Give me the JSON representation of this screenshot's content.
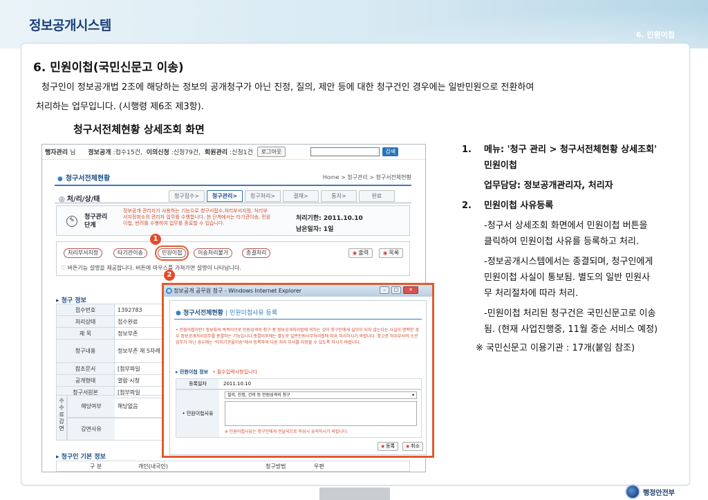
{
  "slide": {
    "title": "정보공개시스템",
    "chapter": "6. 민원이첩",
    "section_title": "6. 민원이첩(국민신문고 이송)",
    "intro_line1": "청구인이 정보공개법 2조에 해당하는 정보의 공개청구가 아닌 진정, 질의, 제안 등에 대한 청구건인 경우에는 일반민원으로 전환하여",
    "intro_line2": "처리하는 업무입니다. (시행령 제6조 제3항).",
    "sub_title": "청구서전체현황 상세조회 화면"
  },
  "screenshot": {
    "topbar": {
      "user": "행자관리",
      "user_suffix": "님",
      "info_label": "정보공개",
      "info_value": ":접수15건,",
      "petition_label": "이의신청",
      "petition_value": ":신청79건,",
      "member_label": "회원관리",
      "member_value": ":신청1건",
      "logout": "로그아웃",
      "search": "검색"
    },
    "page_heading": "청구서전체현황",
    "breadcrumb": "Home > 청구관리 > 청구서전체현황",
    "sub_heading": "처/리/상/태",
    "tabs": [
      "청구접수>",
      "청구관리>",
      "청구처리>",
      "결재>",
      "통지>",
      "완료"
    ],
    "status": {
      "label": "청구관리 단계",
      "note": "정보공개 관리자가 사용하는 기능으로 청구서접수,처리부서지정, 처리부서지정취소의 관리자 업무를 수행합니다. 현 단계에서는 타기관이송, 민원이첩, 반려를 수행하여 업무를 종료할 수 있습니다.",
      "deadline": "처리기한: 2011.10.10",
      "remaining": "남은일자: 1일"
    },
    "actions": [
      "처리부서지정",
      "타기관이송",
      "민원이첩",
      "이송처리불가",
      "종결처리"
    ],
    "outputs": [
      "출력",
      "목록"
    ],
    "hint": "버튼기능 설명을 제공합니다. 버튼에 마우스를 가져가면 설명이 나타납니다.",
    "markers": [
      "1",
      "2"
    ],
    "info_heading": "청구 정보",
    "info_rows": [
      {
        "k": "접수번호",
        "v": "1392783"
      },
      {
        "k": "처리상태",
        "v": "접수완료"
      },
      {
        "k": "제 목",
        "v": "정보부존"
      },
      {
        "k": "청구내용",
        "v": "정보부존 재 5차례"
      },
      {
        "k": "참조문서",
        "v": "[첨부파일"
      },
      {
        "k": "공개형태",
        "v": "열람·시청"
      },
      {
        "k": "청구서원본",
        "v": "[첨부파일"
      }
    ],
    "side_label": "수수료감면",
    "side_rows": [
      {
        "k": "해당여부",
        "v": "해당없음"
      },
      {
        "k": "감면사유",
        "v": ""
      }
    ],
    "basic_heading": "청구인 기본 정보",
    "basic_row": {
      "k1": "구 분",
      "v1": "개인(내국인)",
      "k2": "청구방법",
      "v2": "우편"
    }
  },
  "popup": {
    "window_title": "정보공개 공무원 청구 - Windows Internet Explorer",
    "heading": "청구서전체현황",
    "heading_crumb": "| 민원이첩사유 등록",
    "desc": "• 민원이첩이란? 정보화의 목적이므로 민원성격의 청구 중 정보공개처리법에 의하는 것이 청구인에게 실익이 되지 않는다는 사실이 명백한 경우 정보공개처리업무를 종결하는 기능입니다.종결이후에는 별도로 일반민원사무처리법에 따라 처리하시기 바랍니다. 참고로 처리부서의 소관업무가 아닌 경우에는 \"타처기관을이송\"에서 등록하여 다른 처리 부서를 지정할 수 있도록 하시기 바랍니다.",
    "section": "민원이첩 정보",
    "required": "• 필수입력사항입니다.",
    "date_label": "등록일자",
    "date_value": "2011.10.10",
    "reason_label": "• 민원이첩사유",
    "reason_selected": "질의, 진정, 건의 등 민원성격의 청구",
    "reason_note": "※ 민원이첩사유는 청구인에게 전달되므로 작성시 유의하시기 바랍니다.",
    "buttons": [
      "등록",
      "취소"
    ]
  },
  "right": {
    "item1_num": "1.",
    "item1": "메뉴: '청구 관리 > 청구서전체현황 상세조회' 민원이첩",
    "item1_sub": "업무담당: 정보공개관리자, 처리자",
    "item2_num": "2.",
    "item2": "민원이첩 사유등록",
    "para1": "-청구서 상세조회 화면에서 민원이첩 버튼을 클릭하여 민원이첩 사유를 등록하고 처리.",
    "para2": "-정보공개시스템에서는 종결되며, 청구인에게 민원이첩 사실이 통보됨. 별도의 일반 민원사무 처리절차에 따라 처리.",
    "para3": "-민원이첩 처리된 청구건은 국민신문고로 이송됨. (현재 사업진행중, 11월 중순 서비스 예정)",
    "note": "※ 국민신문고 이용기관 : 17개(붙임 참조)"
  },
  "footer": {
    "logo_text": "행정안전부"
  }
}
